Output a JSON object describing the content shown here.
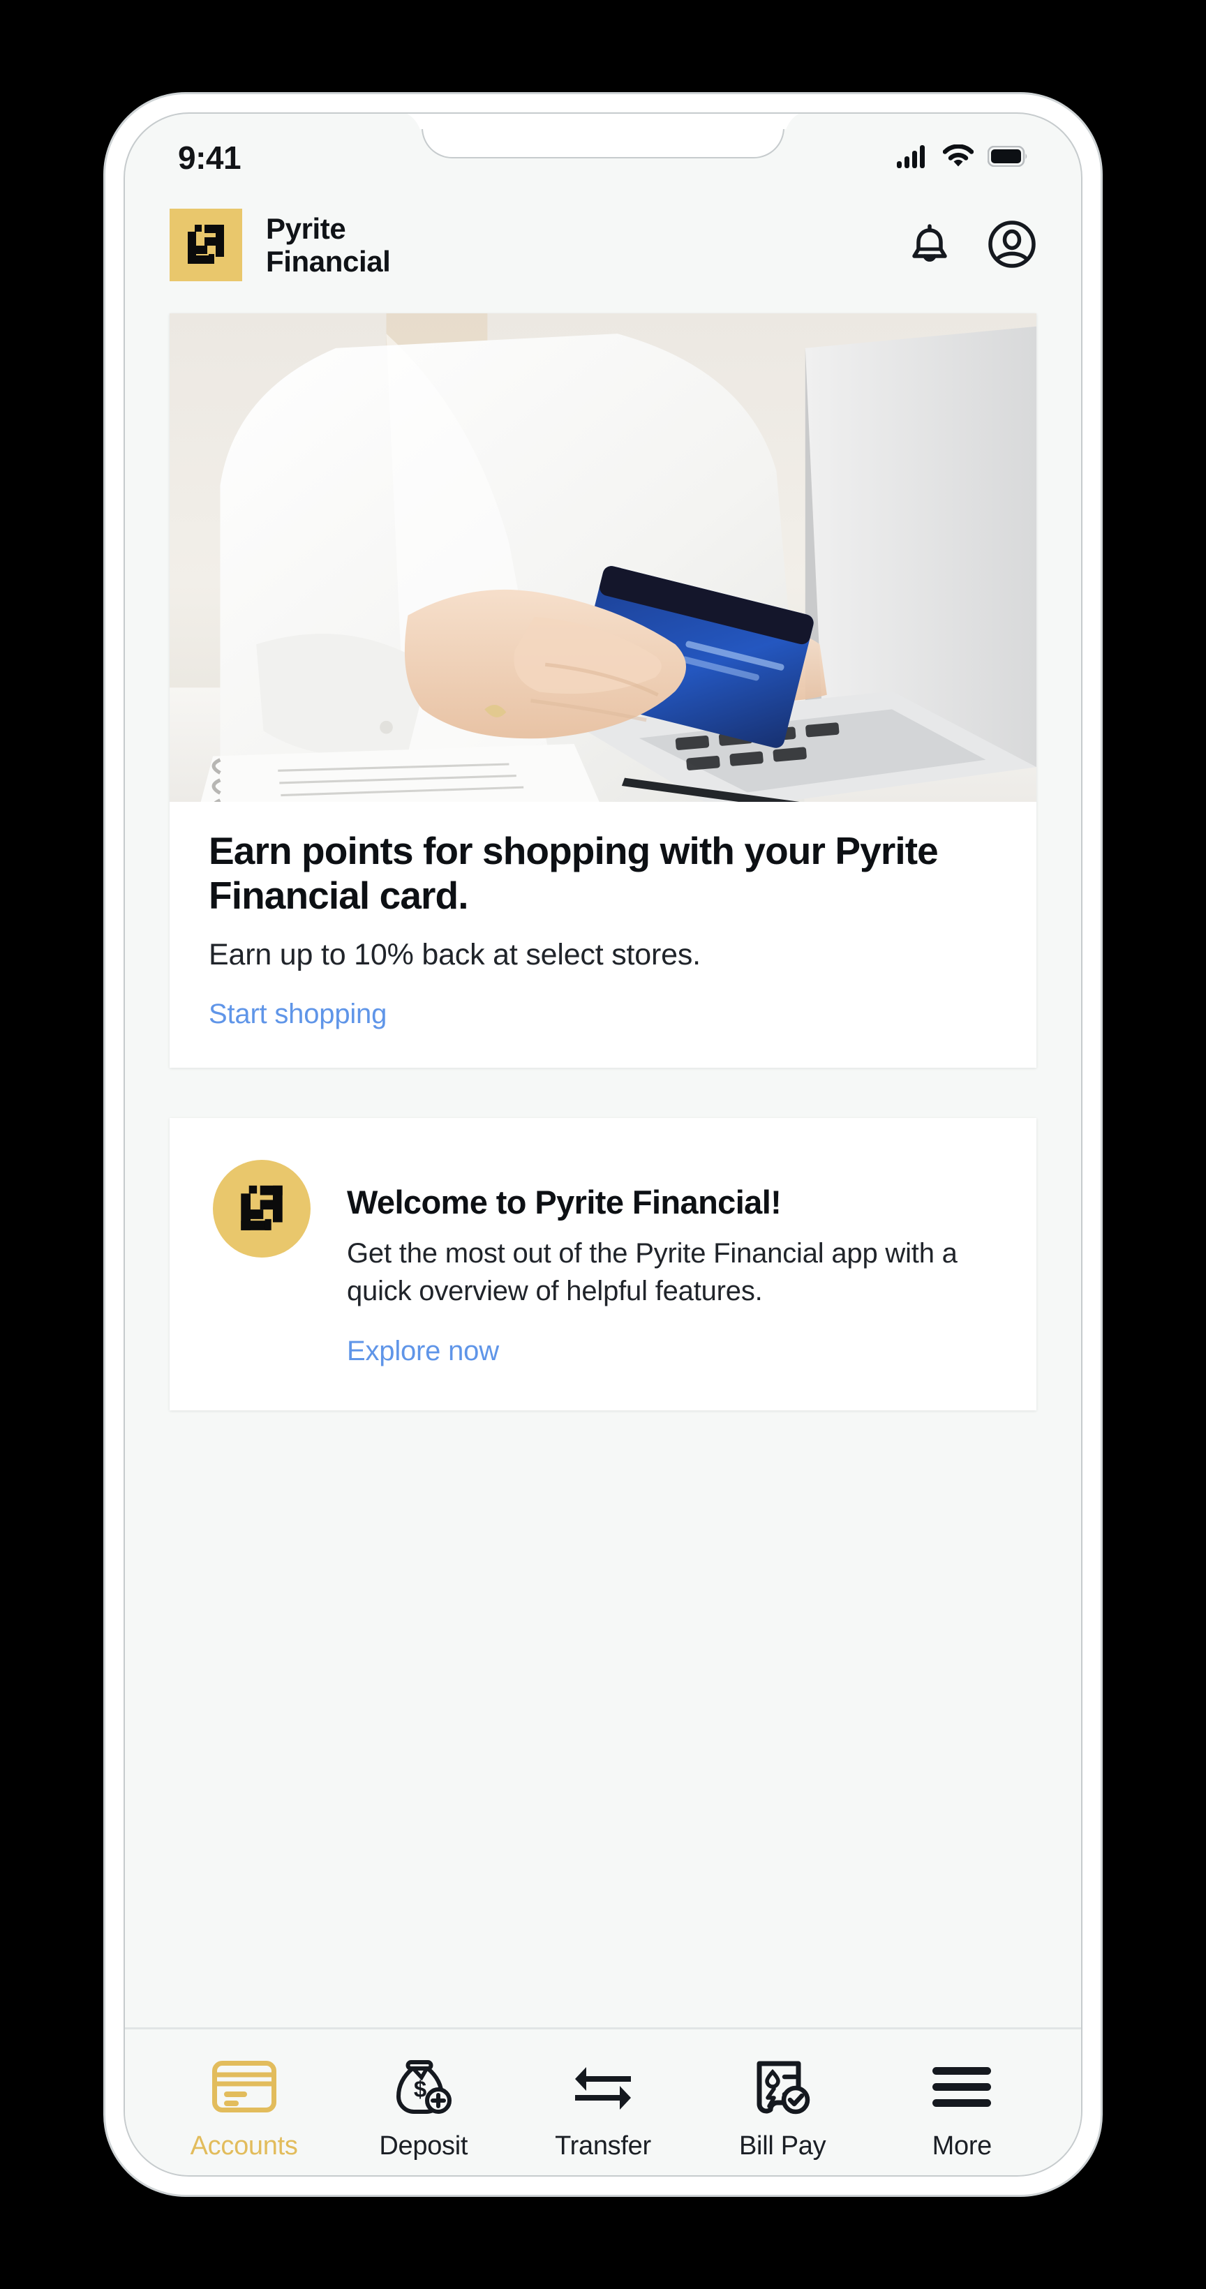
{
  "status_bar": {
    "time": "9:41",
    "icons": [
      "cellular-signal-icon",
      "wifi-icon",
      "battery-icon"
    ]
  },
  "header": {
    "logo_icon": "pyrite-financial-logo-icon",
    "brand_name": "Pyrite\nFinancial",
    "actions": [
      {
        "icon": "bell-icon",
        "name": "notifications-button"
      },
      {
        "icon": "account-circle-icon",
        "name": "profile-button"
      }
    ]
  },
  "promo_card": {
    "hero_image_alt": "person-holding-credit-card-at-laptop",
    "title": "Earn points for shopping with your Pyrite Financial card.",
    "subtitle": "Earn up to 10% back at select stores.",
    "link": "Start shopping"
  },
  "welcome_card": {
    "logo_icon": "pyrite-financial-logo-icon",
    "title": "Welcome to Pyrite Financial!",
    "body": "Get the most out of the Pyrite Financial app with a quick overview of helpful features.",
    "link": "Explore now"
  },
  "bottom_nav": {
    "items": [
      {
        "label": "Accounts",
        "icon": "credit-card-icon",
        "active": true
      },
      {
        "label": "Deposit",
        "icon": "money-bag-plus-icon",
        "active": false
      },
      {
        "label": "Transfer",
        "icon": "transfer-arrows-icon",
        "active": false
      },
      {
        "label": "Bill Pay",
        "icon": "bill-check-icon",
        "active": false
      },
      {
        "label": "More",
        "icon": "hamburger-menu-icon",
        "active": false
      }
    ]
  },
  "colors": {
    "brand_gold": "#e9c76c",
    "active_gold": "#e2bc5c",
    "link_blue": "#5f95e8",
    "app_background": "#f6f8f7",
    "card_background": "#ffffff",
    "text_primary": "#0d1014",
    "page_background": "#000000"
  }
}
